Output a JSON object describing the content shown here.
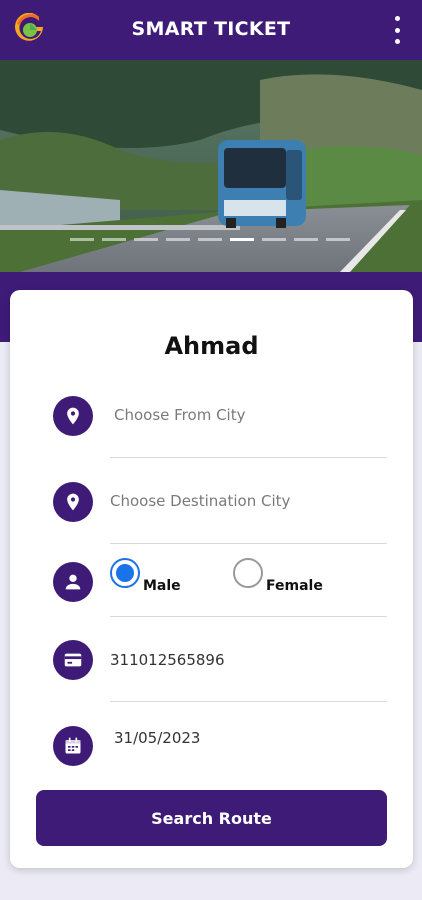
{
  "app": {
    "title": "SMART TICKET",
    "accent_color": "#3f1b78",
    "logo_icon": "app-logo-g",
    "menu_icon": "more-vert-icon"
  },
  "hero": {
    "image": "bus-on-road-banner",
    "slides_count": 9,
    "active_slide": 6
  },
  "form": {
    "user_name": "Ahmad",
    "from_city": {
      "icon": "location-pin-icon",
      "placeholder": "Choose From City"
    },
    "destination_city": {
      "icon": "location-pin-icon",
      "placeholder": "Choose Destination City"
    },
    "gender": {
      "icon": "person-icon",
      "options": [
        "Male",
        "Female"
      ],
      "selected": "Male"
    },
    "cnic": {
      "icon": "card-icon",
      "value": "311012565896"
    },
    "date": {
      "icon": "calendar-icon",
      "value": "31/05/2023"
    },
    "search_label": "Search Route"
  }
}
